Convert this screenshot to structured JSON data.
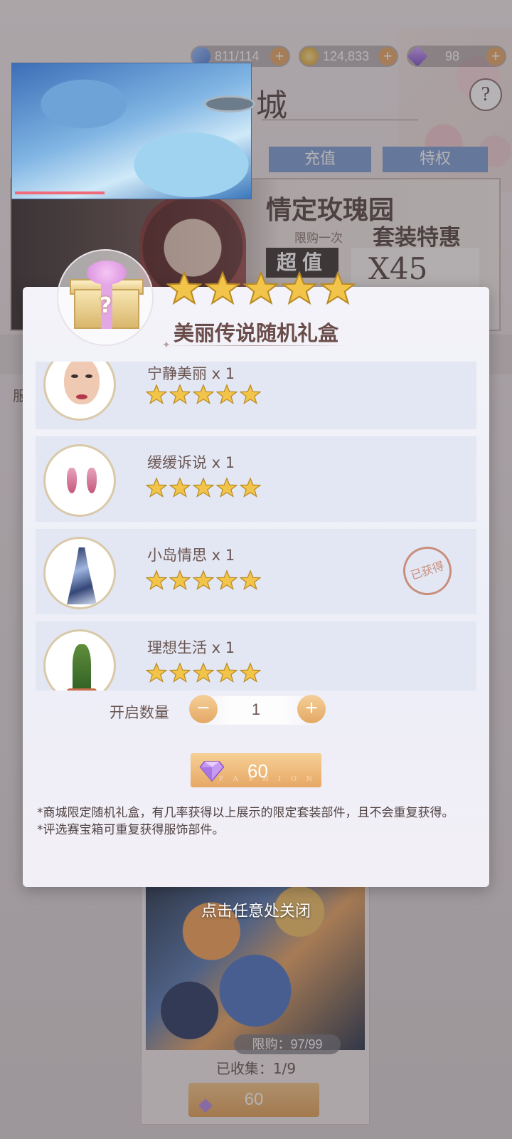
{
  "resources": {
    "energy": "811/114",
    "gold": "124,833",
    "gems": "98",
    "plus": "+"
  },
  "shop": {
    "title_char": "城",
    "help": "?",
    "recharge_label": "充值",
    "privilege_label": "特权"
  },
  "banner": {
    "title": "情定玫瑰园",
    "limit": "限购一次",
    "subtitle": "套装特惠",
    "badge": "超值",
    "price": "X45"
  },
  "background": {
    "category_prefix": "服"
  },
  "modal": {
    "title": "美丽传说随机礼盒",
    "star_count": 5,
    "items": [
      {
        "name": "宁静美丽 x 1",
        "stars": 5,
        "obtained": false,
        "icon": "face-makeup-icon"
      },
      {
        "name": "缓缓诉说 x 1",
        "stars": 5,
        "obtained": false,
        "icon": "earrings-icon"
      },
      {
        "name": "小岛情思 x 1",
        "stars": 5,
        "obtained": true,
        "icon": "dress-icon"
      },
      {
        "name": "理想生活 x 1",
        "stars": 5,
        "obtained": false,
        "icon": "plant-icon"
      }
    ],
    "obtained_label": "已获得",
    "qty_label": "开启数量",
    "qty_minus": "−",
    "qty_plus": "+",
    "qty_value": "1",
    "buy_price": "60",
    "buy_watermark": "FASHION",
    "note1": "*商城限定随机礼盒，有几率获得以上展示的限定套装部件，且不会重复获得。",
    "note2": "*评选赛宝箱可重复获得服饰部件。"
  },
  "close_hint": "点击任意处关闭",
  "bottom_card": {
    "limit": "限购：97/99",
    "collected": "已收集：1/9",
    "price": "60"
  },
  "colors": {
    "accent_gold": "#e6a866",
    "button_blue": "#7f9ed4",
    "modal_bg": "#eceef8",
    "stamp": "#c98e7c"
  }
}
